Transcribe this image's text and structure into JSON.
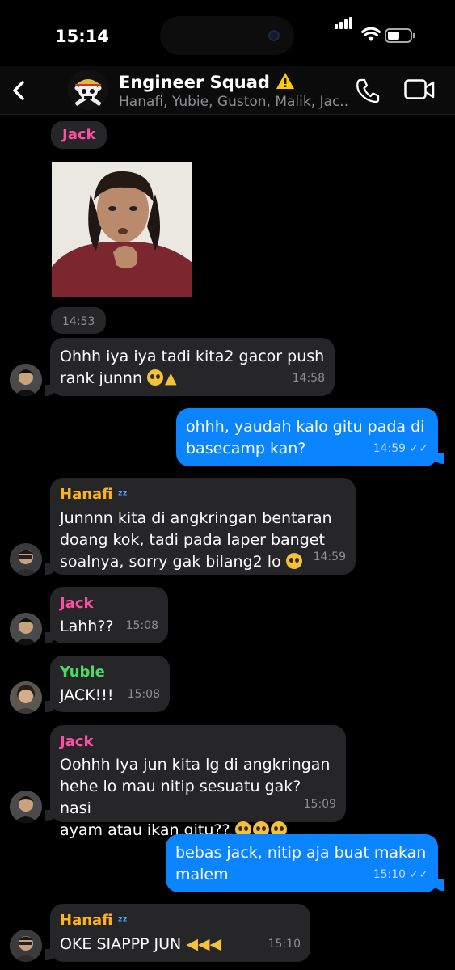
{
  "status": {
    "time": "15:14",
    "battery_fraction": 0.55
  },
  "header": {
    "title": "Engineer Squad",
    "warning_icon": "warning-sign-icon",
    "members": "Hanafi, Yubie, Guston, Malik, Jac..."
  },
  "colors": {
    "jack": "#ff4fa3",
    "hanafi": "#ffb21e",
    "yubie": "#4cd964",
    "outgoing": "#0a84ff",
    "incoming": "#262628"
  },
  "messages": {
    "photo": {
      "sender": "Jack",
      "time": "14:53"
    },
    "m1": {
      "text1": "Ohhh iya iya tadi kita2 gacor push",
      "text2": "rank junnn",
      "time": "14:58"
    },
    "m2": {
      "text1": "ohhh, yaudah kalo gitu pada di",
      "text2": "basecamp kan?",
      "time": "14:59"
    },
    "m3": {
      "sender": "Hanafi",
      "text1": "Junnnn kita di angkringan bentaran",
      "text2": "doang kok, tadi pada laper banget",
      "text3": "soalnya, sorry gak bilang2 lo",
      "time": "14:59"
    },
    "m4": {
      "sender": "Jack",
      "text": "Lahh??",
      "time": "15:08"
    },
    "m5": {
      "sender": "Yubie",
      "text": "JACK!!!",
      "time": "15:08"
    },
    "m6": {
      "sender": "Jack",
      "text1": "Oohhh Iya jun kita lg di angkringan",
      "text2": "hehe lo mau nitip sesuatu gak? nasi",
      "text3": "ayam atau ikan gitu??",
      "time": "15:09"
    },
    "m7": {
      "text1": "bebas jack, nitip aja buat makan",
      "text2": "malem",
      "time": "15:10"
    },
    "m8": {
      "sender": "Hanafi",
      "text": "OKE SIAPPP JUN",
      "time": "15:10"
    }
  }
}
